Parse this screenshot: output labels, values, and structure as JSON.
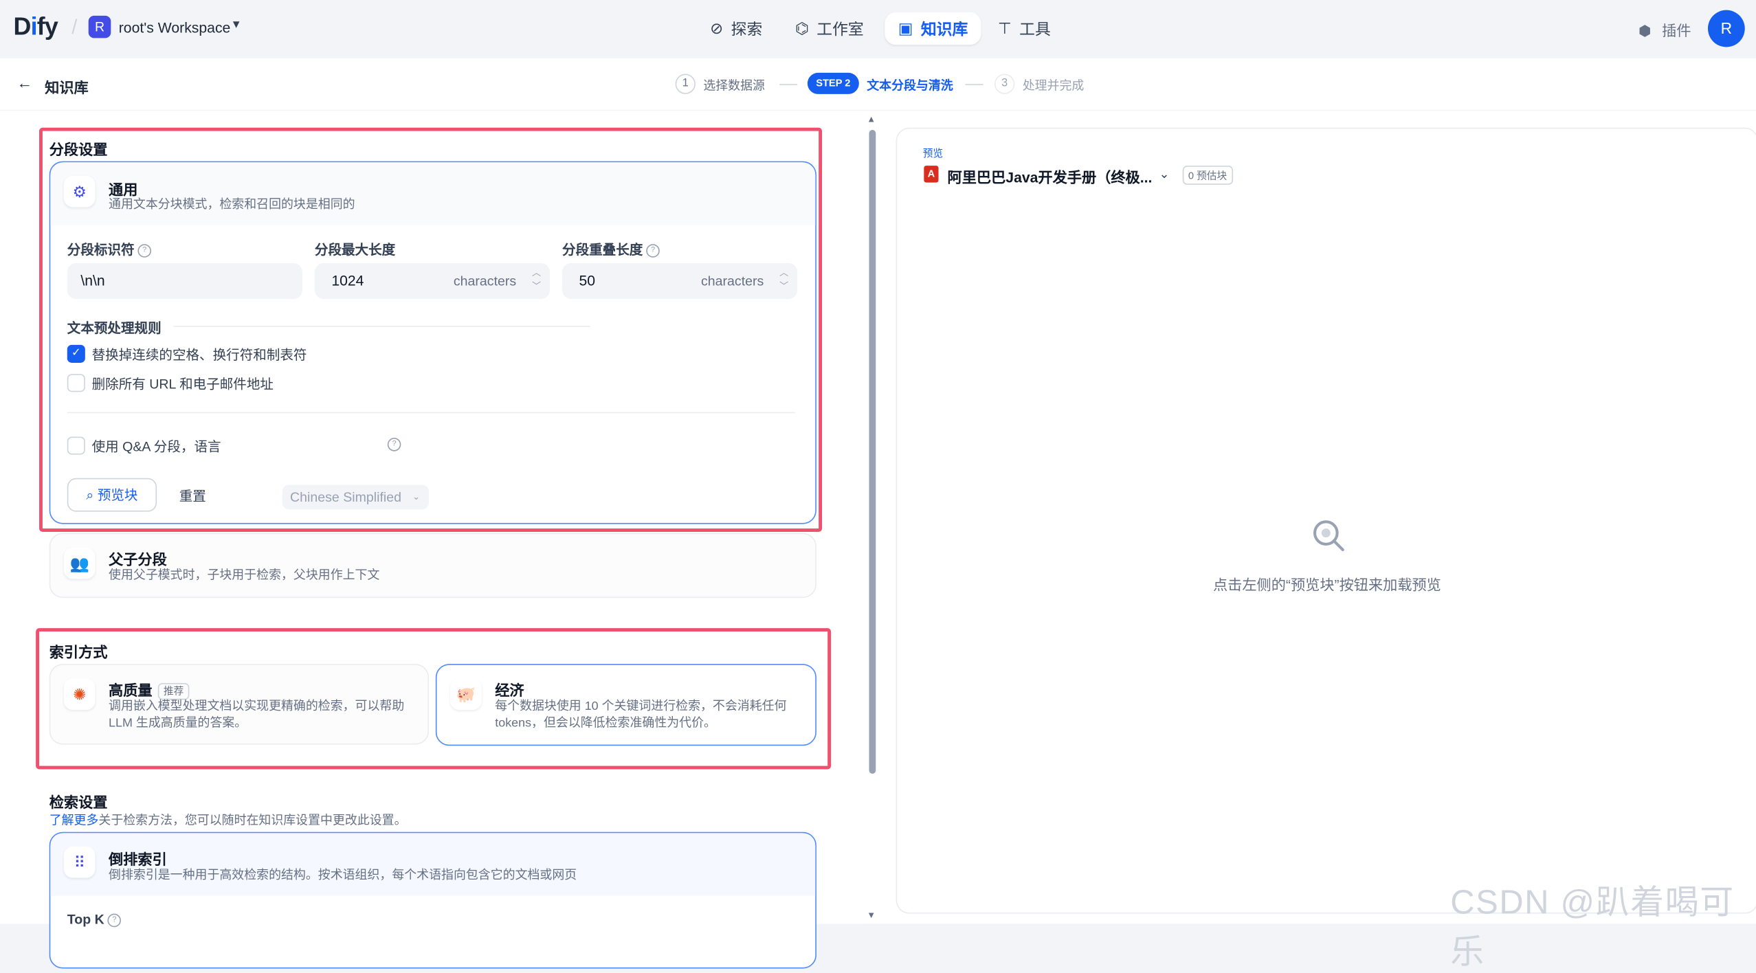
{
  "brand": {
    "logo": "Dify",
    "workspace_initial": "R",
    "workspace_name": "root's Workspace"
  },
  "nav": [
    {
      "label": "探索",
      "icon": "compass-icon"
    },
    {
      "label": "工作室",
      "icon": "robot-icon"
    },
    {
      "label": "知识库",
      "icon": "book-icon",
      "active": true
    },
    {
      "label": "工具",
      "icon": "hammer-icon"
    }
  ],
  "header_right": {
    "plugin_label": "插件",
    "avatar_initial": "R"
  },
  "subheader": {
    "back_label": "知识库"
  },
  "steps": [
    {
      "num": "1",
      "label": "选择数据源"
    },
    {
      "num": "STEP 2",
      "label": "文本分段与清洗",
      "active": true
    },
    {
      "num": "3",
      "label": "处理并完成"
    }
  ],
  "segment": {
    "section_title": "分段设置",
    "general": {
      "title": "通用",
      "desc": "通用文本分块模式，检索和召回的块是相同的",
      "fields": {
        "separator_label": "分段标识符",
        "separator_value": "\\n\\n",
        "max_len_label": "分段最大长度",
        "max_len_value": "1024",
        "max_len_unit": "characters",
        "overlap_label": "分段重叠长度",
        "overlap_value": "50",
        "overlap_unit": "characters"
      },
      "rules_title": "文本预处理规则",
      "rules": [
        {
          "label": "替换掉连续的空格、换行符和制表符",
          "checked": true
        },
        {
          "label": "删除所有 URL 和电子邮件地址",
          "checked": false
        }
      ],
      "qa_label": "使用 Q&A 分段，语言",
      "qa_lang": "Chinese Simplified",
      "preview_btn": "预览块",
      "reset_btn": "重置"
    },
    "parent_child": {
      "title": "父子分段",
      "desc": "使用父子模式时，子块用于检索，父块用作上下文"
    }
  },
  "index": {
    "section_title": "索引方式",
    "high_quality": {
      "title": "高质量",
      "badge": "推荐",
      "desc_line1": "调用嵌入模型处理文档以实现更精确的检索，可以帮助",
      "desc_line2": "LLM 生成高质量的答案。"
    },
    "economy": {
      "title": "经济",
      "desc_line1": "每个数据块使用 10 个关键词进行检索，不会消耗任何",
      "desc_line2": "tokens，但会以降低检索准确性为代价。"
    }
  },
  "retrieval": {
    "section_title": "检索设置",
    "learn_link": "了解更多",
    "learn_rest": "关于检索方法，您可以随时在知识库设置中更改此设置。",
    "inverted": {
      "title": "倒排索引",
      "desc": "倒排索引是一种用于高效检索的结构。按术语组织，每个术语指向包含它的文档或网页"
    },
    "topk_label": "Top K"
  },
  "preview": {
    "label": "预览",
    "doc_name": "阿里巴巴Java开发手册（终极...",
    "est_badge": "0 预估块",
    "empty_text": "点击左侧的“预览块”按钮来加载预览"
  },
  "watermark": "CSDN @趴着喝可乐",
  "colors": {
    "accent": "#155eef",
    "highlight_border": "#f0506e"
  }
}
